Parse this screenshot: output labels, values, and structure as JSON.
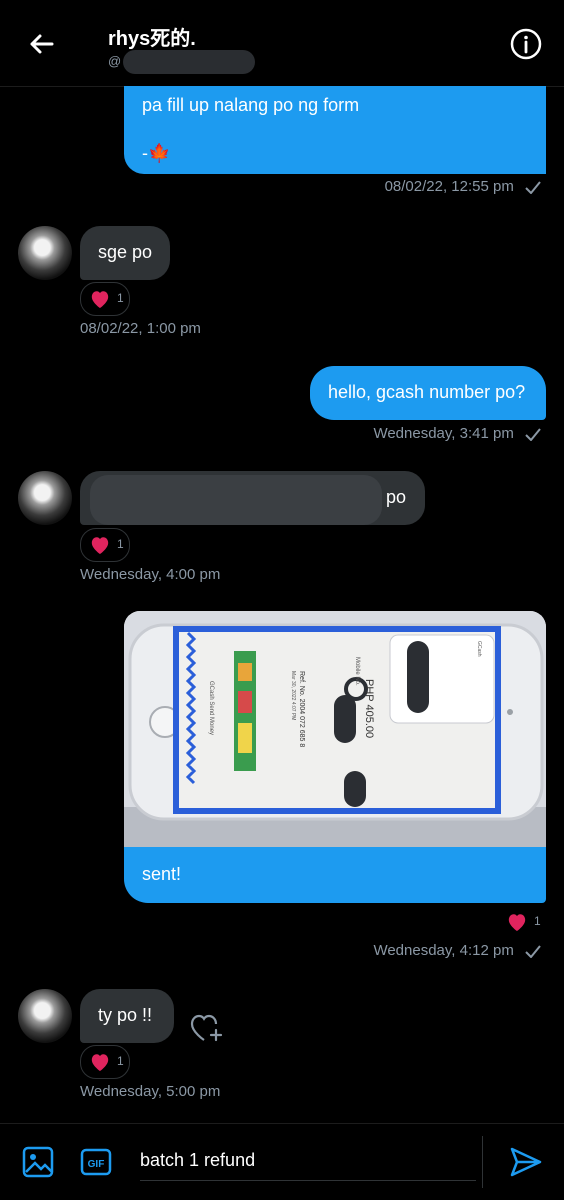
{
  "header": {
    "name": "rhys死的.",
    "handle_prefix": "@"
  },
  "messages": {
    "m1_text": "pa fill up nalang po ng form",
    "m1_sign": "-🍁",
    "m1_meta": "08/02/22, 12:55 pm",
    "m2_text": "sge po",
    "m2_reaction_count": "1",
    "m2_meta": "08/02/22, 1:00 pm",
    "m3_text": "hello, gcash number po?",
    "m3_meta": "Wednesday, 3:41 pm",
    "m4_text_suffix": "po",
    "m4_reaction_count": "1",
    "m4_meta": "Wednesday, 4:00 pm",
    "m5_text": "sent!",
    "m5_reaction_count": "1",
    "m5_meta": "Wednesday, 4:12 pm",
    "m6_text": "ty po !!",
    "m6_reaction_count": "1",
    "m6_meta": "Wednesday, 5:00 pm"
  },
  "photo": {
    "amount": "PHP 405.00",
    "mobile_no_label": "Mobile No.",
    "ref_text": "Ref. No. 2004 072 685 8",
    "date_text": "Mar 30, 2022 4:07 PM",
    "footer_text": "GCash Send Money",
    "notification_text": "GCash"
  },
  "composer": {
    "value": "batch 1 refund"
  },
  "colors": {
    "accent": "#1d9bf0",
    "incoming_bubble": "#2f3336",
    "background": "#000000",
    "heart": "#f91880"
  }
}
